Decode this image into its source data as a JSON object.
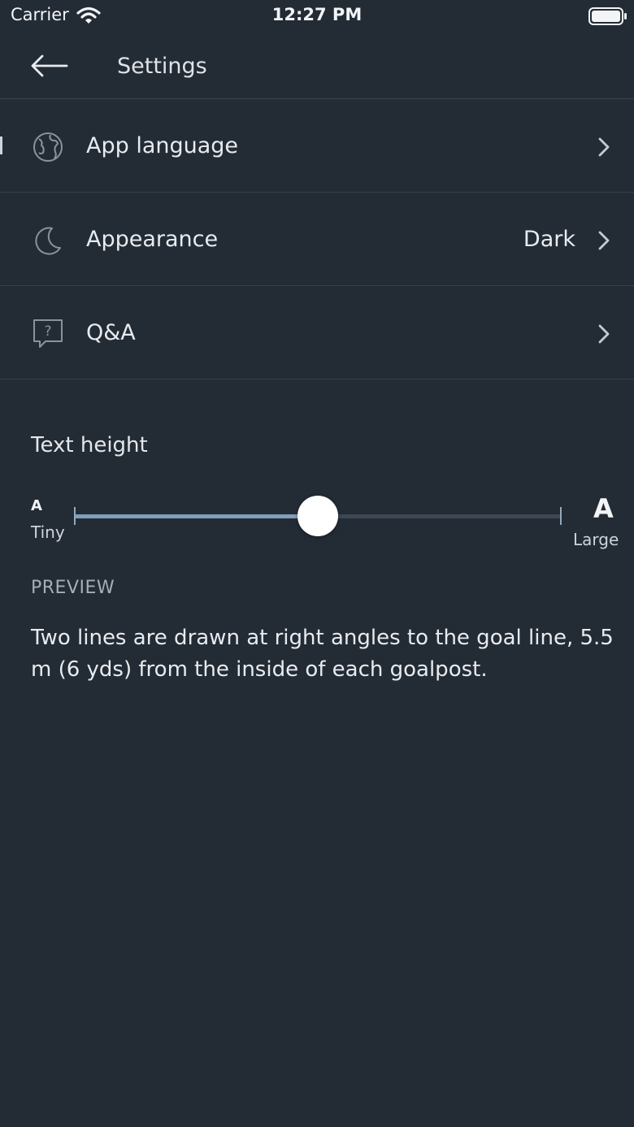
{
  "status_bar": {
    "carrier": "Carrier",
    "time": "12:27 PM"
  },
  "nav": {
    "title": "Settings"
  },
  "settings": {
    "items": [
      {
        "label": "App language",
        "value": "",
        "icon": "globe-icon"
      },
      {
        "label": "Appearance",
        "value": "Dark",
        "icon": "moon-icon"
      },
      {
        "label": "Q&A",
        "value": "",
        "icon": "question-bubble-icon"
      }
    ]
  },
  "text_height": {
    "title": "Text height",
    "min_glyph": "A",
    "min_label": "Tiny",
    "max_glyph": "A",
    "max_label": "Large",
    "value_fraction": 0.5
  },
  "preview": {
    "label": "PREVIEW",
    "text": "Two lines are drawn at right angles to the goal line, 5.5 m (6 yds) from the inside of each goalpost."
  },
  "colors": {
    "background": "#232b35",
    "accent": "#7f9fb8"
  }
}
